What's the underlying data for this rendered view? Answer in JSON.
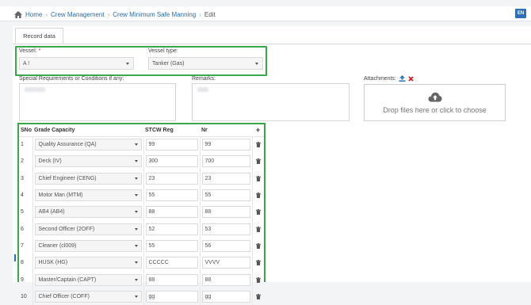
{
  "breadcrumb": {
    "home": "Home",
    "items": [
      "Crew Management",
      "Crew Minimum Safe Manning",
      "Edit"
    ]
  },
  "language": "EN",
  "tab": {
    "label": "Record data"
  },
  "vessel": {
    "label": "Vessel:",
    "required_mark": "*",
    "value": "A !"
  },
  "vessel_type": {
    "label": "Vessel type:",
    "value": "Tanker (Gas)"
  },
  "special_requirements": {
    "label": "Special Requirements or Conditions if any:"
  },
  "remarks": {
    "label": "Remarks:"
  },
  "attachments": {
    "label": "Attachments:",
    "dropzone_text": "Drop files here or click to choose"
  },
  "table": {
    "headers": {
      "sno": "SNo",
      "grade": "Grade Capacity",
      "stcw": "STCW Reg",
      "nr": "Nr",
      "add": "+"
    },
    "rows": [
      {
        "sno": "1",
        "grade": "Quality Assurance (QA)",
        "stcw": "99",
        "nr": "99"
      },
      {
        "sno": "2",
        "grade": "Deck (IV)",
        "stcw": "300",
        "nr": "700"
      },
      {
        "sno": "3",
        "grade": "Chief Engineer (CENG)",
        "stcw": "23",
        "nr": "23"
      },
      {
        "sno": "4",
        "grade": "Motor Man (MTM)",
        "stcw": "55",
        "nr": "55"
      },
      {
        "sno": "5",
        "grade": "AB4 (AB4)",
        "stcw": "88",
        "nr": "88"
      },
      {
        "sno": "6",
        "grade": "Second Officer (2OFF)",
        "stcw": "52",
        "nr": "53"
      },
      {
        "sno": "7",
        "grade": "Cleaner (cl009)",
        "stcw": "55",
        "nr": "56"
      },
      {
        "sno": "8",
        "grade": "HUSK (HG)",
        "stcw": "CCCCC",
        "nr": "VVVV"
      },
      {
        "sno": "9",
        "grade": "Master/Captain (CAPT)",
        "stcw": "88",
        "nr": "88"
      },
      {
        "sno": "10",
        "grade": "Chief Officer (COFF)",
        "stcw": "gg",
        "nr": "gg"
      }
    ]
  },
  "colors": {
    "highlight": "#3aa84a",
    "accent": "#2f6fb6",
    "danger": "#d22222"
  },
  "icons": {
    "home": "home-icon",
    "upload": "upload-icon",
    "remove": "remove-icon",
    "cloud": "cloud-upload-icon",
    "trash": "trash-icon",
    "caret": "chevron-down-icon"
  }
}
